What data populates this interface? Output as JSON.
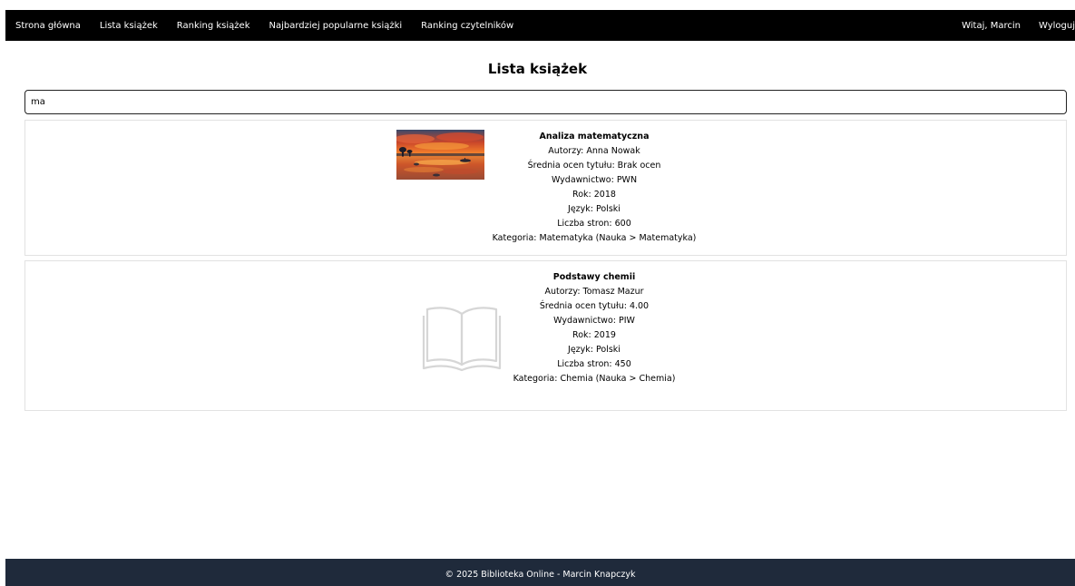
{
  "nav": {
    "left": [
      {
        "label": "Strona główna"
      },
      {
        "label": "Lista książek"
      },
      {
        "label": "Ranking książek"
      },
      {
        "label": "Najbardziej popularne książki"
      },
      {
        "label": "Ranking czytelników"
      }
    ],
    "greeting": "Witaj, Marcin",
    "logout": "Wyloguj"
  },
  "page": {
    "title": "Lista książek"
  },
  "search": {
    "value": "ma"
  },
  "books": [
    {
      "title": "Analiza matematyczna",
      "authors": "Autorzy: Anna Nowak",
      "rating": "Średnia ocen tytułu: Brak ocen",
      "publisher": "Wydawnictwo: PWN",
      "year": "Rok: 2018",
      "language": "Język: Polski",
      "pages": "Liczba stron: 600",
      "category": "Kategoria: Matematyka (Nauka > Matematyka)",
      "cover": "sunset-photo"
    },
    {
      "title": "Podstawy chemii",
      "authors": "Autorzy: Tomasz Mazur",
      "rating": "Średnia ocen tytułu: 4.00",
      "publisher": "Wydawnictwo: PIW",
      "year": "Rok: 2019",
      "language": "Język: Polski",
      "pages": "Liczba stron: 450",
      "category": "Kategoria: Chemia (Nauka > Chemia)",
      "cover": "book-placeholder-icon"
    }
  ],
  "footer": {
    "text": "© 2025 Biblioteka Online - Marcin Knapczyk"
  }
}
